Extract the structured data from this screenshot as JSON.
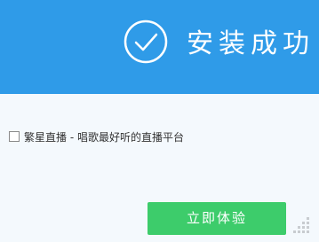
{
  "banner": {
    "title": "安装成功",
    "background_color": "#2f9be8",
    "icon": "check-circle-icon"
  },
  "option": {
    "checked": false,
    "label": "繁星直播 - 唱歌最好听的直播平台"
  },
  "actions": {
    "primary_label": "立即体验",
    "primary_color": "#3dcc6b"
  }
}
